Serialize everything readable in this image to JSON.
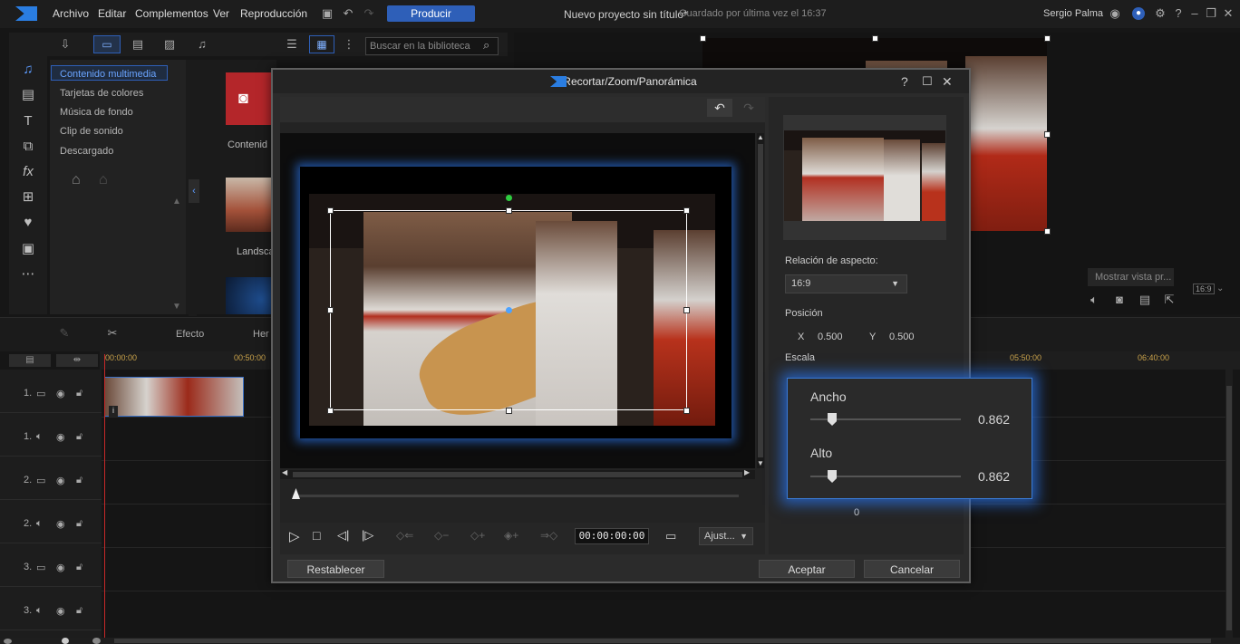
{
  "menubar": {
    "items": [
      "Archivo",
      "Editar",
      "Complementos",
      "Ver",
      "Reproducción"
    ],
    "produce": "Producir",
    "project": "Nuevo proyecto sin título*",
    "saved": "Guardado por última vez el 16:37",
    "user": "Sergio Palma"
  },
  "library": {
    "search_placeholder": "Buscar en la biblioteca",
    "items": [
      "Contenido multimedia",
      "Tarjetas de colores",
      "Música de fondo",
      "Clip de sonido",
      "Descargado"
    ],
    "thumb1": "Contenid",
    "thumb2": "Landsca"
  },
  "preview": {
    "show_more": "Mostrar vista pr...",
    "ratio": "16:9"
  },
  "timeline": {
    "tools": [
      "Efecto",
      "Her"
    ],
    "ruler": [
      "00:00:00",
      "00:50:00",
      "05:50:00",
      "06:40:00"
    ],
    "tracks": [
      "1.",
      "1.",
      "2.",
      "2.",
      "3.",
      "3."
    ]
  },
  "dialog": {
    "title": "Recortar/Zoom/Panorámica",
    "aspect_label": "Relación de aspecto:",
    "aspect_value": "16:9",
    "position_label": "Posición",
    "x_label": "X",
    "x_value": "0.500",
    "y_label": "Y",
    "y_value": "0.500",
    "scale_label": "Escala",
    "timecode": "00:00:00:00",
    "adjust": "Ajust...",
    "reset": "Restablecer",
    "accept": "Aceptar",
    "cancel": "Cancelar",
    "zero": "0"
  },
  "scale": {
    "width_label": "Ancho",
    "width_value": "0.862",
    "width_pos": 0.862,
    "height_label": "Alto",
    "height_value": "0.862",
    "height_pos": 0.862
  },
  "colors": {
    "accent": "#2e5fb8",
    "glow": "#3a7bd5"
  }
}
